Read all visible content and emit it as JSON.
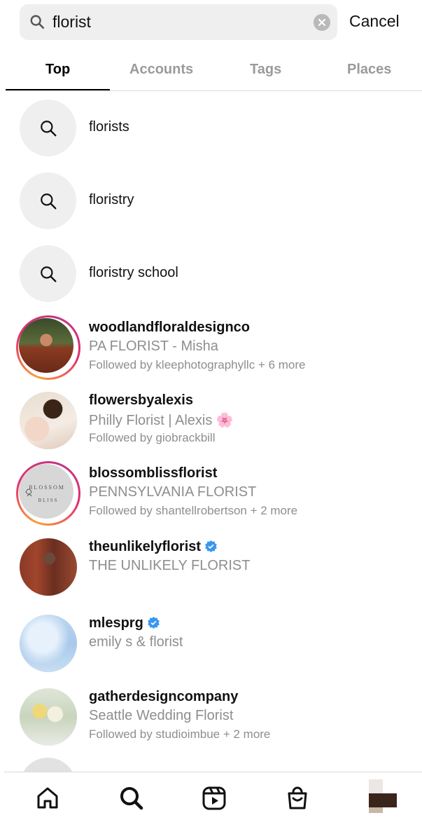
{
  "search": {
    "query": "florist",
    "cancel_label": "Cancel"
  },
  "tabs": [
    {
      "label": "Top",
      "active": true
    },
    {
      "label": "Accounts",
      "active": false
    },
    {
      "label": "Tags",
      "active": false
    },
    {
      "label": "Places",
      "active": false
    }
  ],
  "suggestions": [
    "florists",
    "floristry",
    "floristry school"
  ],
  "accounts": [
    {
      "username": "woodlandfloraldesignco",
      "name": "PA FLORIST - Misha",
      "followed_by": "Followed by kleephotographyllc + 6 more",
      "story_ring": true,
      "verified": false
    },
    {
      "username": "flowersbyalexis",
      "name": "Philly Florist | Alexis 🌸",
      "followed_by": "Followed by giobrackbill",
      "story_ring": false,
      "verified": false
    },
    {
      "username": "blossomblissflorist",
      "name": "PENNSYLVANIA FLORIST",
      "followed_by": "Followed by shantellrobertson + 2 more",
      "story_ring": true,
      "verified": false,
      "avatar_text": [
        "BLOSSOM",
        "BLISS"
      ]
    },
    {
      "username": "theunlikelyflorist",
      "name": "THE UNLIKELY FLORIST",
      "followed_by": "",
      "story_ring": false,
      "verified": true
    },
    {
      "username": "mlesprg",
      "name": "emily s & florist",
      "followed_by": "",
      "story_ring": false,
      "verified": true
    },
    {
      "username": "gatherdesigncompany",
      "name": "Seattle Wedding Florist",
      "followed_by": "Followed by studioimbue + 2 more",
      "story_ring": false,
      "verified": false
    }
  ],
  "nav": [
    "home-icon",
    "search-icon",
    "reels-icon",
    "shop-icon",
    "profile-avatar"
  ],
  "colors": {
    "verified_blue": "#3897f0",
    "secondary_text": "#8e8e8e",
    "search_bg": "#efefef"
  }
}
